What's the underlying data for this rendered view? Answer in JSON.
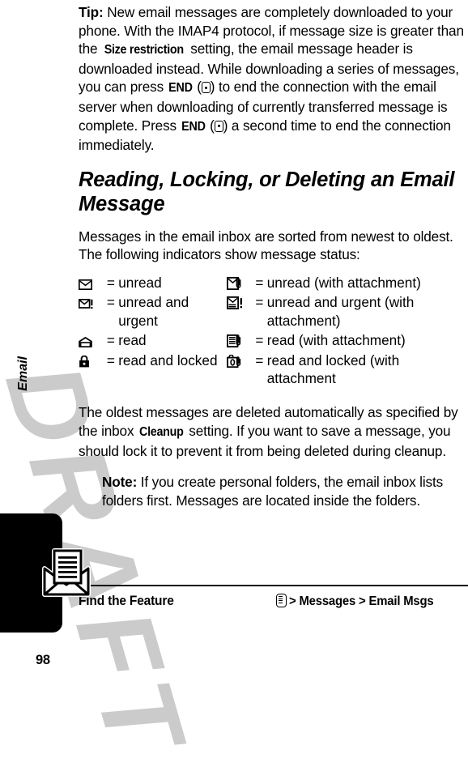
{
  "page": {
    "number": "98",
    "watermark": "DRAFT",
    "chapter_label": "Email",
    "chapter_icon": "envelope-letter-icon"
  },
  "colors": {
    "text": "#000000",
    "background": "#ffffff",
    "watermark": "#c9c9c9",
    "chapter_tab": "#000000"
  },
  "tip_paragraph": {
    "label": "Tip:",
    "seg1": " New email messages are completely downloaded to your phone. With the IMAP4 protocol, if message size is greater than the ",
    "term1": "Size restriction",
    "seg2": " setting, the email message header is downloaded instead. While downloading a series of messages, you can press ",
    "key1": "END",
    "seg3": " (",
    "seg4": ") to end the connection with the email server when downloading of currently transferred message is complete. Press ",
    "key2": "END",
    "seg5": " (",
    "seg6": ") a second time to end the connection immediately."
  },
  "section": {
    "title": "Reading, Locking, or Deleting an Email Message",
    "intro": "Messages in the email inbox are sorted from newest to oldest. The following indicators show message status:"
  },
  "indicators": {
    "equals": "=",
    "rows": [
      {
        "left": {
          "icon": "unread-envelope-icon",
          "text": "unread"
        },
        "right": {
          "icon": "unread-envelope-attachment-icon",
          "text": "unread (with attachment)"
        }
      },
      {
        "left": {
          "icon": "unread-urgent-envelope-icon",
          "text": "unread and urgent"
        },
        "right": {
          "icon": "unread-urgent-envelope-attachment-icon",
          "text": "unread and urgent (with attachment)"
        }
      },
      {
        "left": {
          "icon": "read-envelope-icon",
          "text": "read"
        },
        "right": {
          "icon": "read-document-attachment-icon",
          "text": "read (with attachment)"
        }
      },
      {
        "left": {
          "icon": "locked-padlock-icon",
          "text": "read and locked"
        },
        "right": {
          "icon": "read-locked-attachment-icon",
          "text": "read and locked (with attachment"
        }
      }
    ]
  },
  "cleanup_paragraph": {
    "seg1": "The oldest messages are deleted automatically as specified by the inbox ",
    "term1": "Cleanup",
    "seg2": " setting. If you want to save a message, you should lock it to prevent it from being deleted during cleanup."
  },
  "note_paragraph": {
    "label": "Note:",
    "text": " If you create personal folders, the email inbox lists folders first. Messages are located inside the folders."
  },
  "find_the_feature": {
    "label": "Find the Feature",
    "menu_icon": "menu-key-icon",
    "path": "> Messages > Email Msgs"
  }
}
